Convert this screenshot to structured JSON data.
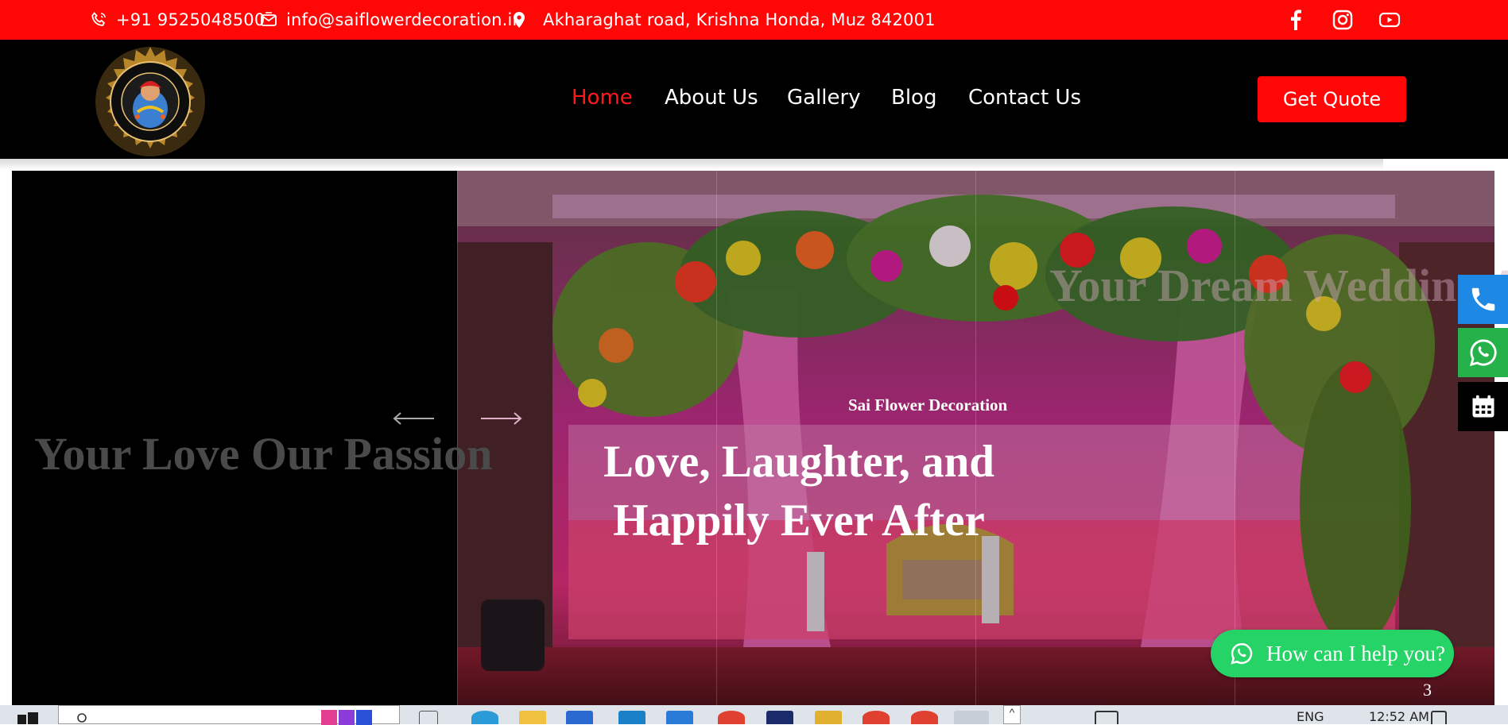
{
  "topbar": {
    "phone": "+91 9525048500",
    "email": "info@saiflowerdecoration.in",
    "address": "Akharaghat road, Krishna Honda, Muz 842001",
    "social": [
      "facebook-icon",
      "instagram-icon",
      "youtube-icon"
    ]
  },
  "nav": {
    "items": [
      "Home",
      "About Us",
      "Gallery",
      "Blog",
      "Contact Us"
    ],
    "active": "Home",
    "cta": "Get Quote"
  },
  "hero": {
    "subtitle": "Sai Flower Decoration",
    "title": "Love, Laughter, and Happily Ever After",
    "prev_slide_title": "Your Love Our Passion",
    "next_slide_title": "Your Dream Wedding Awaits"
  },
  "floating": {
    "help_label": "How can I help you?",
    "slide_counter": "3"
  },
  "taskbar": {
    "language": "ENG",
    "time": "12:52 AM"
  },
  "colors": {
    "brand_red": "#ff0707",
    "whatsapp_green": "#25d366",
    "call_blue": "#1e88e5",
    "header_black": "#000000"
  }
}
